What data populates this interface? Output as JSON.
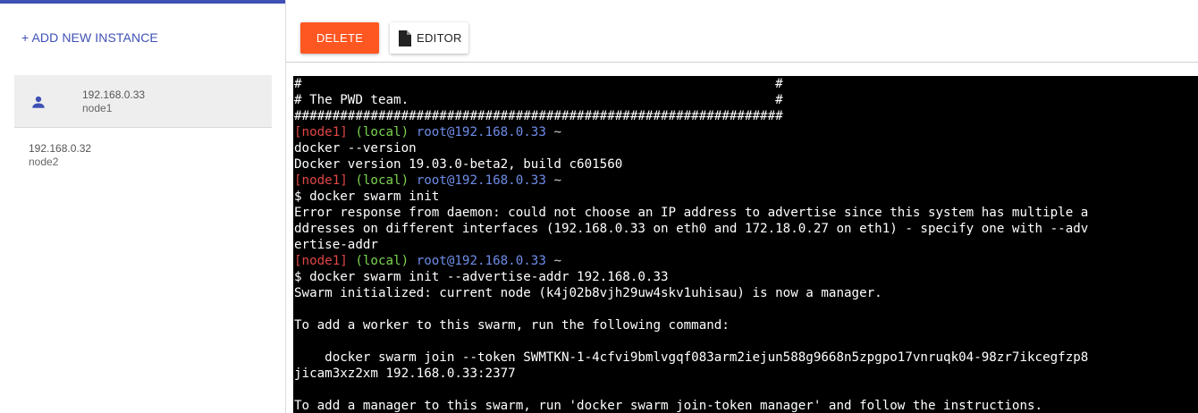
{
  "sidebar": {
    "add_label": "+ ADD NEW INSTANCE",
    "instances": [
      {
        "ip": "192.168.0.33",
        "host": "node1",
        "active": true
      },
      {
        "ip": "192.168.0.32",
        "host": "node2",
        "active": false
      }
    ]
  },
  "toolbar": {
    "delete_label": "DELETE",
    "editor_label": "EDITOR"
  },
  "colors": {
    "accent": "#3f51b5",
    "delete": "#ff5722",
    "prompt_node": "#e04646",
    "prompt_local": "#7cd450",
    "prompt_root": "#6f8ce8"
  },
  "terminal": {
    "lines": [
      {
        "type": "text",
        "text": "#                                                              #"
      },
      {
        "type": "text",
        "text": "# The PWD team.                                                #"
      },
      {
        "type": "text",
        "text": "################################################################"
      },
      {
        "type": "prompt",
        "node": "[node1]",
        "local": "(local)",
        "user": "root@192.168.0.33",
        "tilde": "~"
      },
      {
        "type": "text",
        "text": "docker --version"
      },
      {
        "type": "text",
        "text": "Docker version 19.03.0-beta2, build c601560"
      },
      {
        "type": "prompt",
        "node": "[node1]",
        "local": "(local)",
        "user": "root@192.168.0.33",
        "tilde": "~"
      },
      {
        "type": "text",
        "text": "$ docker swarm init"
      },
      {
        "type": "text",
        "text": "Error response from daemon: could not choose an IP address to advertise since this system has multiple a"
      },
      {
        "type": "text",
        "text": "ddresses on different interfaces (192.168.0.33 on eth0 and 172.18.0.27 on eth1) - specify one with --adv"
      },
      {
        "type": "text",
        "text": "ertise-addr"
      },
      {
        "type": "prompt",
        "node": "[node1]",
        "local": "(local)",
        "user": "root@192.168.0.33",
        "tilde": "~"
      },
      {
        "type": "text",
        "text": "$ docker swarm init --advertise-addr 192.168.0.33"
      },
      {
        "type": "text",
        "text": "Swarm initialized: current node (k4j02b8vjh29uw4skv1uhisau) is now a manager."
      },
      {
        "type": "text",
        "text": ""
      },
      {
        "type": "text",
        "text": "To add a worker to this swarm, run the following command:"
      },
      {
        "type": "text",
        "text": ""
      },
      {
        "type": "text",
        "text": "    docker swarm join --token SWMTKN-1-4cfvi9bmlvgqf083arm2iejun588g9668n5zpgpo17vnruqk04-98zr7ikcegfzp8"
      },
      {
        "type": "text",
        "text": "jicam3xz2xm 192.168.0.33:2377"
      },
      {
        "type": "text",
        "text": ""
      },
      {
        "type": "text",
        "text": "To add a manager to this swarm, run 'docker swarm join-token manager' and follow the instructions."
      }
    ]
  }
}
